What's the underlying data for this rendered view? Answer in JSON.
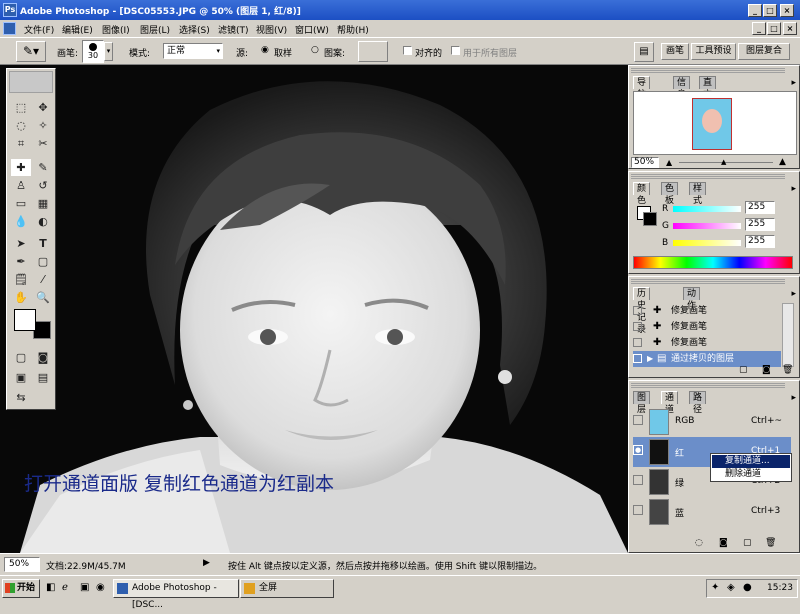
{
  "window": {
    "title": "Adobe Photoshop - [DSC05553.JPG @ 50% (图层 1, 红/8)]"
  },
  "menu": [
    "文件(F)",
    "编辑(E)",
    "图像(I)",
    "图层(L)",
    "选择(S)",
    "滤镜(T)",
    "视图(V)",
    "窗口(W)",
    "帮助(H)"
  ],
  "options": {
    "brush_label": "画笔:",
    "brush_size": "30",
    "mode_label": "模式:",
    "mode_value": "正常",
    "source_label": "源:",
    "sampled_label": "取样",
    "pattern_label": "图案:",
    "aligned_label": "对齐的",
    "all_layers_label": "用于所有图层",
    "tab_brushes": "画笔",
    "tab_tool_presets": "工具预设",
    "tab_layer_comps": "图层复合"
  },
  "canvas": {
    "caption": "打开通道面版  复制红色通道为红副本",
    "caption_color": "#1a2a8a"
  },
  "navigator": {
    "tabs": [
      "导航器",
      "信息",
      "直方图"
    ],
    "zoom": "50%"
  },
  "color_panel": {
    "tabs": [
      "颜色",
      "色板",
      "样式"
    ],
    "r_label": "R",
    "r_value": "255",
    "g_label": "G",
    "g_value": "255",
    "b_label": "B",
    "b_value": "255"
  },
  "history": {
    "tabs": [
      "历史记录",
      "动作"
    ],
    "items": [
      "修复画笔",
      "修复画笔",
      "修复画笔",
      "通过拷贝的图层"
    ]
  },
  "channels": {
    "tabs": [
      "图层",
      "通道",
      "路径"
    ],
    "rows": [
      {
        "name": "RGB",
        "shortcut": "Ctrl+~"
      },
      {
        "name": "红",
        "shortcut": "Ctrl+1"
      },
      {
        "name": "绿",
        "shortcut": "Ctrl+2"
      },
      {
        "name": "蓝",
        "shortcut": "Ctrl+3"
      }
    ],
    "context_menu": [
      "复制通道...",
      "删除通道"
    ]
  },
  "status": {
    "zoom": "50%",
    "doc": "文档:22.9M/45.7M",
    "hint": "按住 Alt 键点按以定义源，然后点按并拖移以绘画。使用 Shift 键以限制描边。"
  },
  "taskbar": {
    "start": "开始",
    "task1": "Adobe Photoshop - [DSC...",
    "task2": "全屏",
    "clock": "15:23"
  },
  "colors": {
    "titlebar": "#1c4fc4",
    "highlight": "#6b8ec9",
    "face": "#d4d0c8"
  }
}
